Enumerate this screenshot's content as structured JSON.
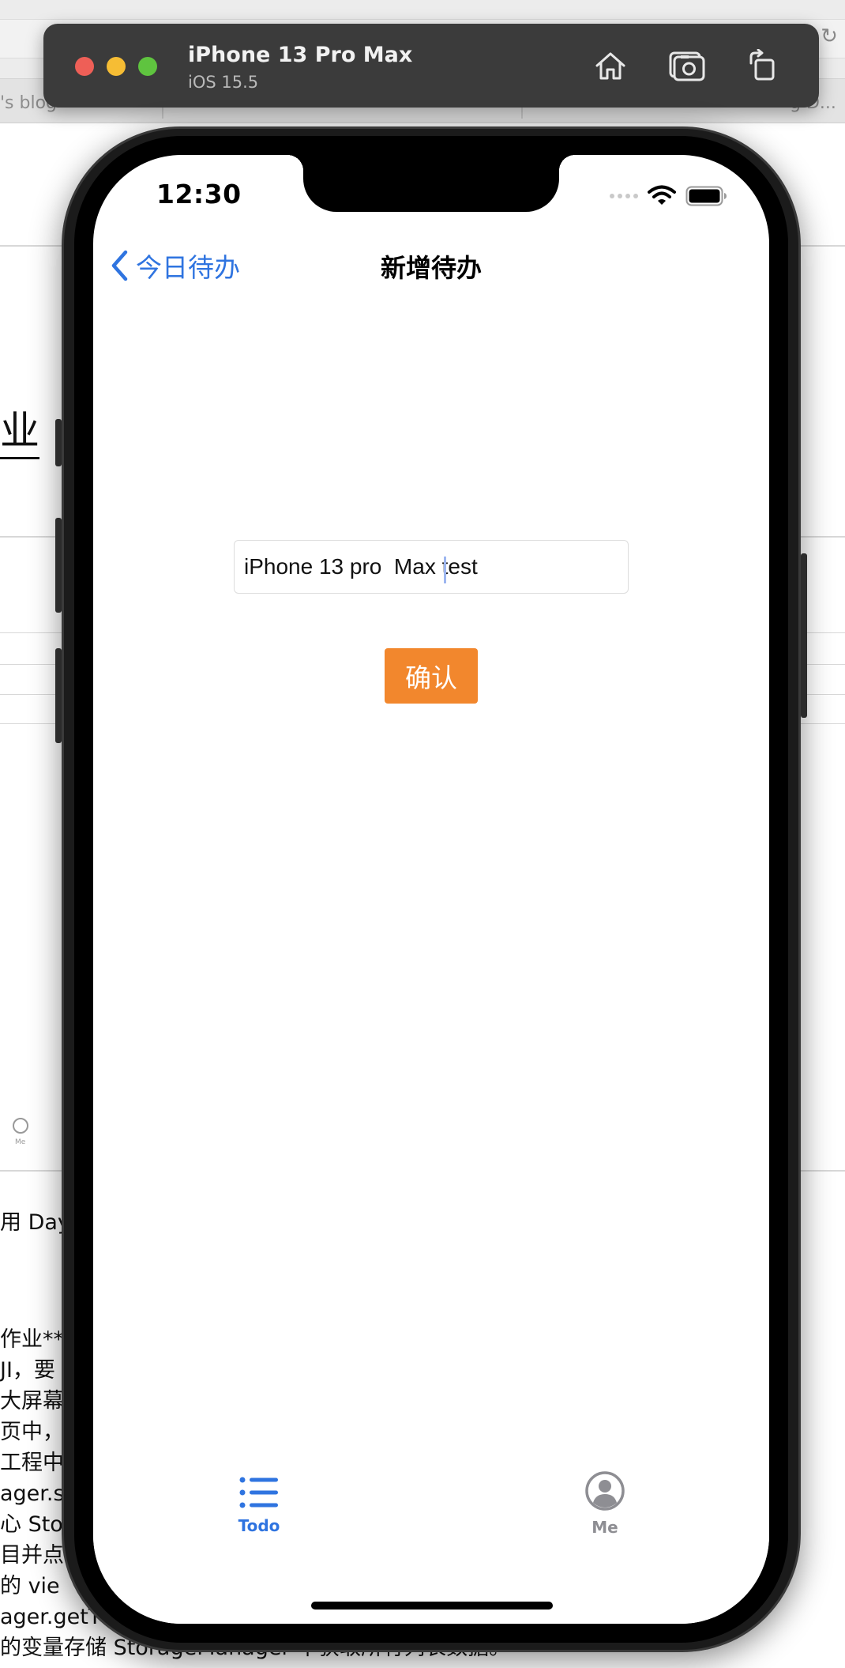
{
  "background": {
    "tabs": [
      "'s blog",
      "",
      "",
      "g D..."
    ],
    "fragments": {
      "big_heading": "业",
      "day_line": "用 Day",
      "lines": [
        "作业**",
        "JI，要",
        "大屏幕",
        "页中，",
        "工程中",
        "ager.s",
        "心 Stor",
        "目并点",
        "的 vie",
        "ager.getT",
        "的变量存储 StorageManager 中获取所有列表数据。"
      ]
    },
    "mini_tab_label": "Me"
  },
  "simulator": {
    "device_name": "iPhone 13 Pro Max",
    "os_version": "iOS 15.5",
    "buttons": {
      "home": "home-icon",
      "screenshot": "camera-icon",
      "rotate": "rotate-icon"
    }
  },
  "status_bar": {
    "time": "12:30"
  },
  "nav": {
    "back_label": "今日待办",
    "title": "新增待办"
  },
  "form": {
    "input_value": "iPhone 13 pro  Max test",
    "confirm_label": "确认"
  },
  "tabbar": {
    "items": [
      {
        "label": "Todo",
        "icon": "list-icon",
        "active": true
      },
      {
        "label": "Me",
        "icon": "person-circle-icon",
        "active": false
      }
    ]
  },
  "colors": {
    "accent_blue": "#2f74e0",
    "confirm_orange": "#f2872d",
    "inactive_gray": "#8e8e93"
  }
}
